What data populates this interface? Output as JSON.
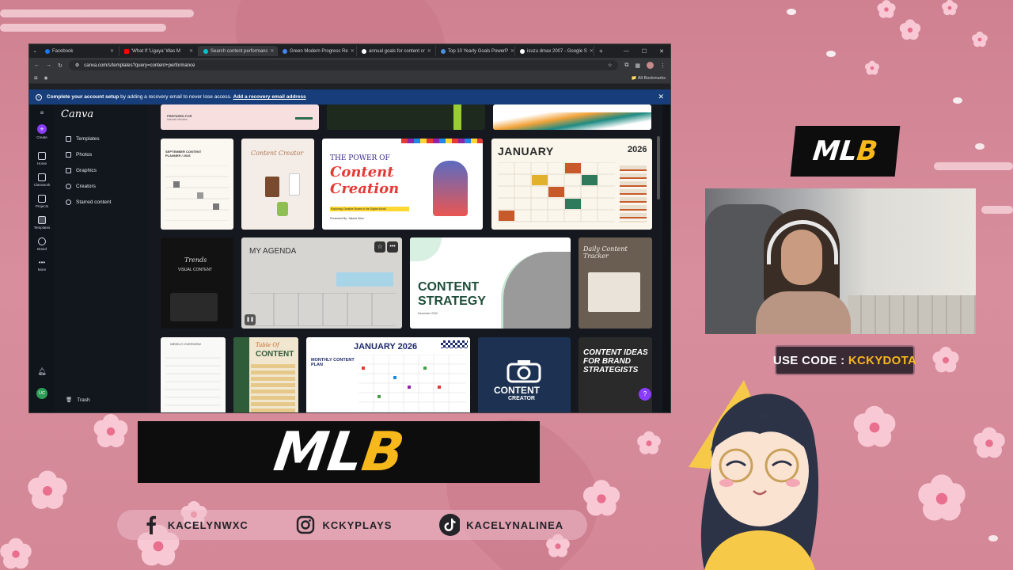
{
  "browser": {
    "tabs": [
      {
        "label": "Facebook",
        "color": "#1877f2"
      },
      {
        "label": "'What If 'Ligaya' Was M",
        "color": "#ff0000"
      },
      {
        "label": "Search content performanc",
        "color": "#00c4cc",
        "active": true
      },
      {
        "label": "Green Modern Progress Re",
        "color": "#4285f4"
      },
      {
        "label": "annual goals for content cr",
        "color": "#ffffff"
      },
      {
        "label": "Top 10 Yearly Goals PowerP",
        "color": "#4a90e2"
      },
      {
        "label": "isuzu dmax 2007 - Google S",
        "color": "#ffffff"
      }
    ],
    "url": "canva.com/s/templates?query=content+performance",
    "bookmarks": "All Bookmarks",
    "banner_bold": "Complete your account setup",
    "banner_text": " by adding a recovery email to never lose access.",
    "banner_link": "Add a recovery email address"
  },
  "canva": {
    "logo": "Canva",
    "rail": [
      {
        "label": "Create"
      },
      {
        "label": "Home"
      },
      {
        "label": "Classwork"
      },
      {
        "label": "Projects"
      },
      {
        "label": "Templates"
      },
      {
        "label": "Brand"
      },
      {
        "label": "More"
      }
    ],
    "nav": [
      "Templates",
      "Photos",
      "Graphics",
      "Creators",
      "Starred content"
    ],
    "trash": "Trash",
    "avatar": "UC",
    "cards": {
      "prepared_for": "PREPARED FOR",
      "prepared_name": "Hannah Morales",
      "planner_title": "SEPTEMBER CONTENT PLANNER / 2026",
      "content_creator": "Content Creator",
      "power_of": "THE POWER OF",
      "content_creation": "Content Creation",
      "power_sub": "Exploring Creative Boxes in the Digital World",
      "presented_by": "Presented By: Juliana Silva",
      "january": "JANUARY",
      "year": "2026",
      "trends": "Trends",
      "visual_content": "VISUAL CONTENT",
      "agenda": "MY AGENDA",
      "strategy_1": "CONTENT",
      "strategy_2": "STRATEGY",
      "strategy_date": "December 2030",
      "daily_tracker": "Daily Content Tracker",
      "weekly": "WEEKLY OVERVIEW",
      "table_of": "Table Of",
      "table_content": "CONTENT",
      "jan_2026": "JANUARY 2026",
      "monthly_plan": "MONTHLY CONTENT PLAN",
      "cc_1": "CONTENT",
      "cc_2": "CREATOR",
      "ideas": "CONTENT IDEAS FOR BRAND STRATEGISTS",
      "help": "?"
    }
  },
  "overlay": {
    "brand_logo_white": "ML",
    "brand_logo_yellow": "B",
    "code_prefix": "USE CODE : ",
    "code": "KCKYDOTA",
    "socials": [
      {
        "icon": "facebook-icon",
        "handle": "KACELYNWXC"
      },
      {
        "icon": "instagram-icon",
        "handle": "KCKYPLAYS"
      },
      {
        "icon": "tiktok-icon",
        "handle": "KACELYNALINEA"
      }
    ],
    "accent_yellow": "#f7b81b",
    "background_pink": "#d38797"
  }
}
